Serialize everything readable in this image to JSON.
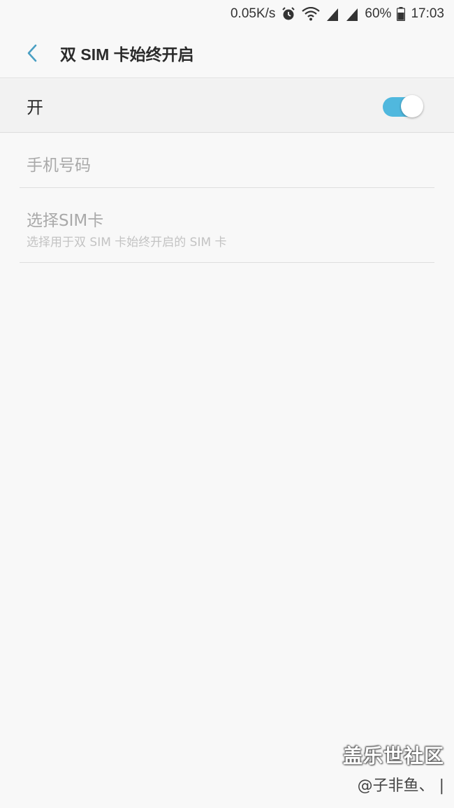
{
  "statusbar": {
    "net_speed": "0.05K/s",
    "battery_percent": "60%",
    "time": "17:03",
    "icons": [
      "alarm-icon",
      "wifi-icon",
      "signal-4g-icon",
      "signal-e-icon",
      "battery-icon"
    ]
  },
  "appbar": {
    "title": "双 SIM 卡始终开启",
    "back_icon": "chevron-left-icon",
    "accent_color": "#50b8de"
  },
  "master_switch": {
    "label": "开",
    "on": true
  },
  "items": [
    {
      "title": "手机号码"
    },
    {
      "title": "选择SIM卡",
      "subtitle": "选择用于双 SIM 卡始终开启的 SIM 卡"
    }
  ],
  "watermark": {
    "brand": "盖乐世社区",
    "user": "@子非鱼、 |"
  }
}
